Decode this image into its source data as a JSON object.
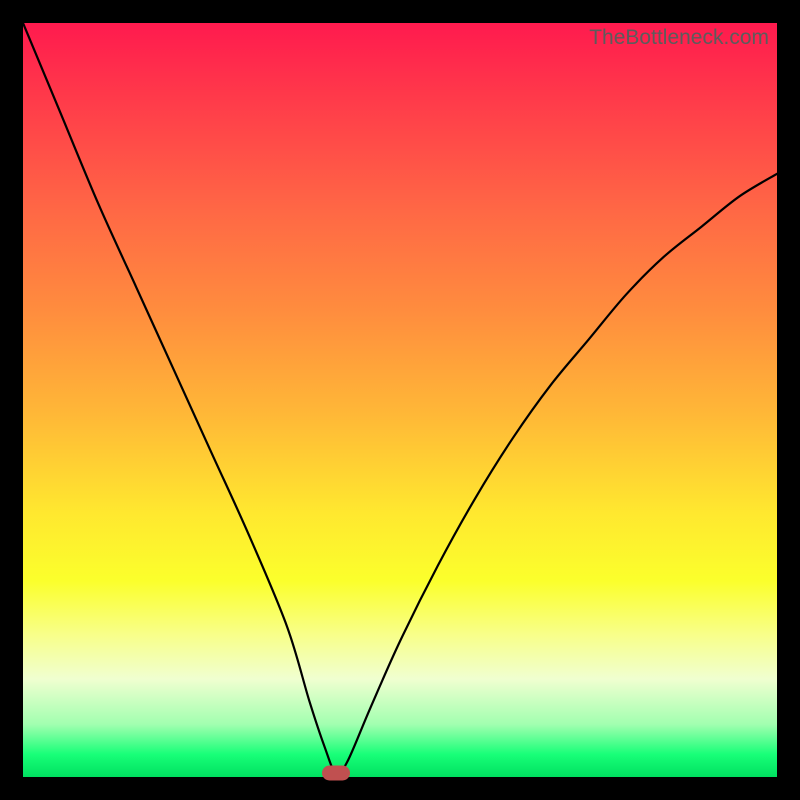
{
  "watermark": "TheBottleneck.com",
  "chart_data": {
    "type": "line",
    "title": "",
    "xlabel": "",
    "ylabel": "",
    "xlim": [
      0,
      100
    ],
    "ylim": [
      0,
      100
    ],
    "grid": false,
    "legend": false,
    "series": [
      {
        "name": "curve",
        "x": [
          0,
          5,
          10,
          15,
          20,
          25,
          30,
          35,
          38,
          40,
          41.5,
          43,
          46,
          50,
          55,
          60,
          65,
          70,
          75,
          80,
          85,
          90,
          95,
          100
        ],
        "y": [
          100,
          88,
          76,
          65,
          54,
          43,
          32,
          20,
          10,
          4,
          0.5,
          2,
          9,
          18,
          28,
          37,
          45,
          52,
          58,
          64,
          69,
          73,
          77,
          80
        ]
      }
    ],
    "marker": {
      "x": 41.5,
      "y": 0.5,
      "color": "#c05050"
    },
    "background_gradient": {
      "top": "#ff1a4e",
      "mid": "#ffe82f",
      "bottom": "#00e060"
    }
  }
}
